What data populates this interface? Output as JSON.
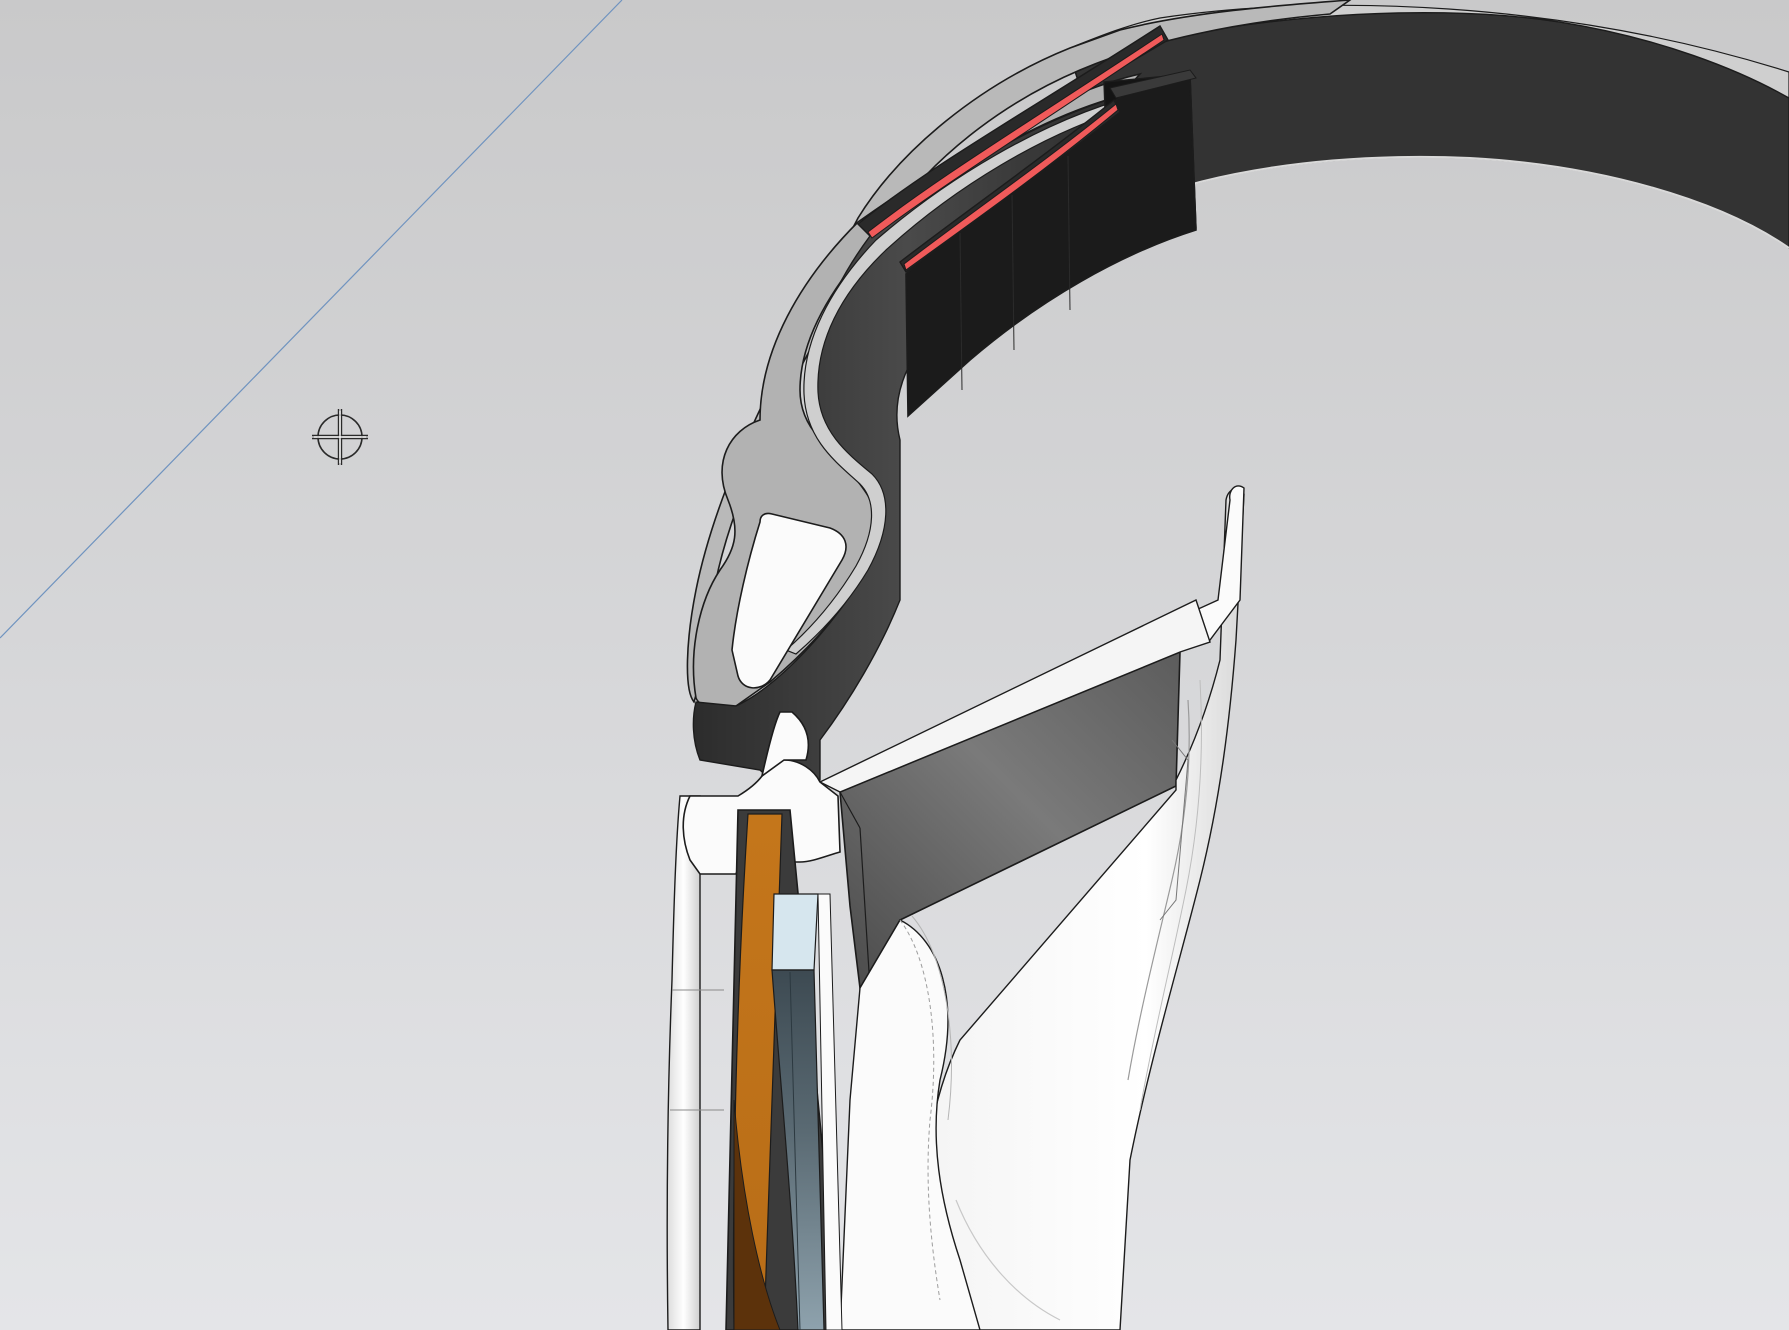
{
  "viewport": {
    "background_top": "#c9c9ca",
    "background_bottom": "#e4e5e8",
    "construction_line_color": "#6f93bf",
    "cursor_icon": "crosshair-target-icon"
  },
  "colors": {
    "outline": "#1c1c1c",
    "section_face": "#b7b7b7",
    "section_face_light": "#d2d2d2",
    "dark_band": "#3a3a3a",
    "darker_band": "#1b1b1b",
    "band_mid": "#5b5b5b",
    "band_light": "#7c7c7c",
    "red_strip": "#f05a5a",
    "white_part": "#fbfbfb",
    "white_shade": "#e9e9ea",
    "orange_layer": "#c4761b",
    "orange_dark": "#5c320b",
    "glass_light": "#d6e6ee",
    "glass_dark": "#3d4a52",
    "glass_mid": "#8ea2ad"
  }
}
